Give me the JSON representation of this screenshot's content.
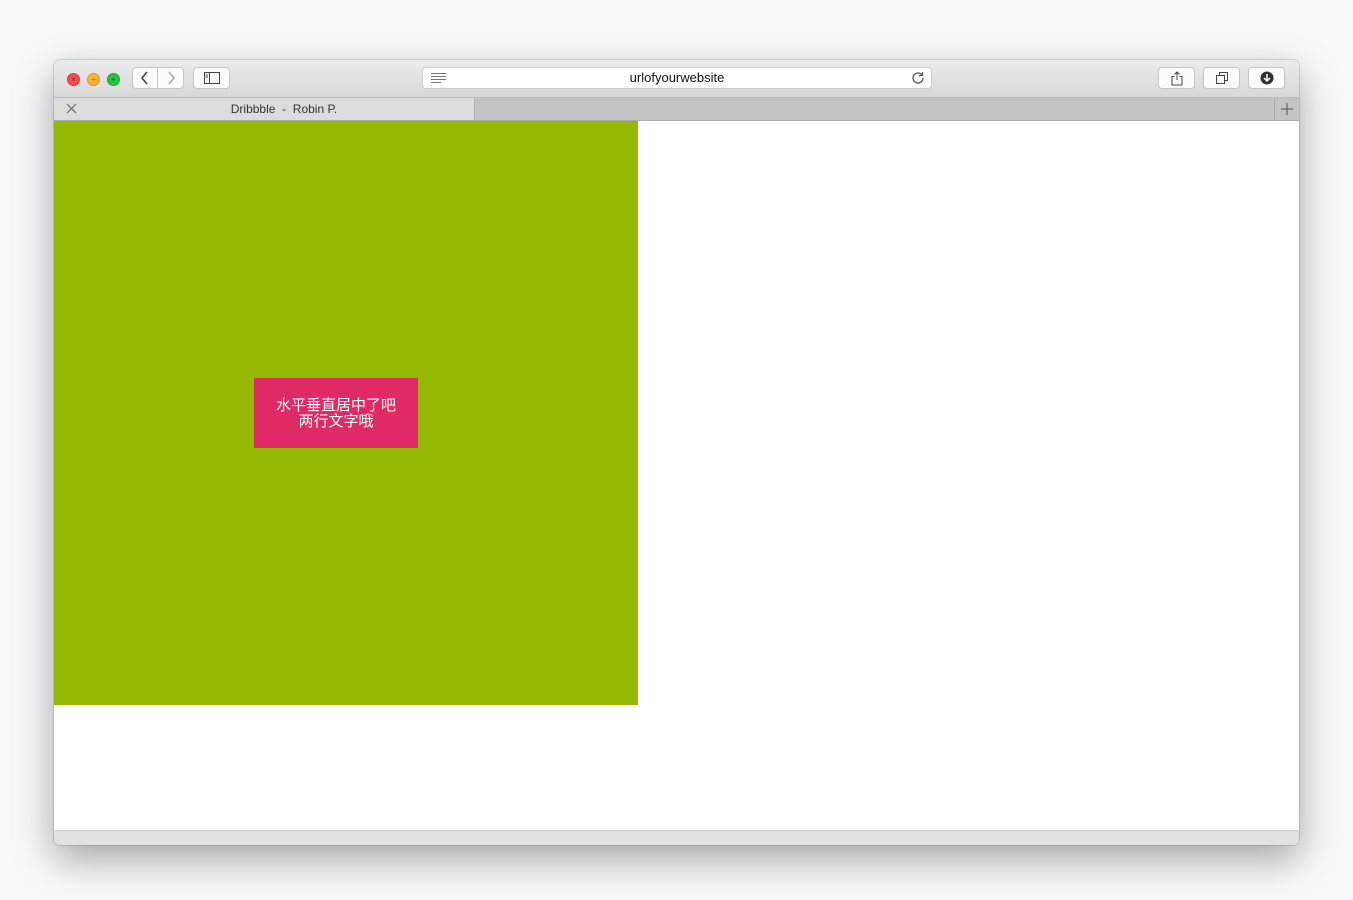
{
  "browser": {
    "url": "urlofyourwebsite",
    "icons": {
      "close": "close-icon",
      "minimize": "minimize-icon",
      "zoom": "zoom-icon",
      "back": "chevron-left-icon",
      "forward": "chevron-right-icon",
      "sidebar": "sidebar-icon",
      "reader": "reader-icon",
      "reload": "reload-icon",
      "share": "share-icon",
      "tabs": "tabs-icon",
      "downloads": "download-icon",
      "new_tab": "plus-icon"
    }
  },
  "tabs": [
    {
      "title": "Dribbble  -  Robin P.",
      "active": true
    }
  ],
  "page": {
    "box_color": "#94b900",
    "label_color": "#e02a66",
    "label_lines": [
      "水平垂直居中了吧",
      "两行文字哦"
    ]
  }
}
